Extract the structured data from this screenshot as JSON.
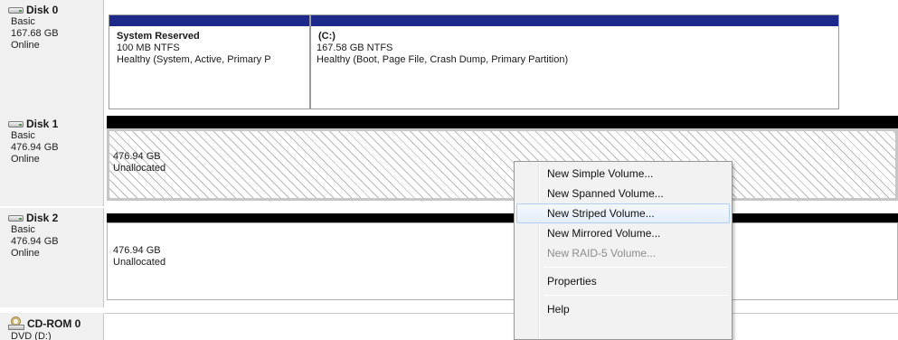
{
  "disks": [
    {
      "name": "Disk 0",
      "type": "Basic",
      "size": "167.68 GB",
      "status": "Online",
      "volumes": [
        {
          "title": "System Reserved",
          "size": "100 MB NTFS",
          "status": "Healthy (System, Active, Primary P",
          "bar_color": "#1d2a8c"
        },
        {
          "title": "(C:)",
          "size": "167.58 GB NTFS",
          "status": "Healthy (Boot, Page File, Crash Dump, Primary Partition)",
          "bar_color": "#1d2a8c"
        }
      ]
    },
    {
      "name": "Disk 1",
      "type": "Basic",
      "size": "476.94 GB",
      "status": "Online",
      "volumes": [
        {
          "size": "476.94 GB",
          "status": "Unallocated",
          "bar_color": "#000000"
        }
      ]
    },
    {
      "name": "Disk 2",
      "type": "Basic",
      "size": "476.94 GB",
      "status": "Online",
      "volumes": [
        {
          "size": "476.94 GB",
          "status": "Unallocated",
          "bar_color": "#000000"
        }
      ]
    },
    {
      "name": "CD-ROM 0",
      "type": "DVD (D:)"
    }
  ],
  "context_menu": {
    "items": [
      {
        "label": "New Simple Volume...",
        "enabled": true
      },
      {
        "label": "New Spanned Volume...",
        "enabled": true
      },
      {
        "label": "New Striped Volume...",
        "enabled": true,
        "highlighted": true
      },
      {
        "label": "New Mirrored Volume...",
        "enabled": true
      },
      {
        "label": "New RAID-5 Volume...",
        "enabled": false
      },
      {
        "label": "Properties",
        "enabled": true
      },
      {
        "label": "Help",
        "enabled": true
      }
    ]
  },
  "colors": {
    "primary_partition_bar": "#1d2a8c",
    "unallocated_bar": "#000000",
    "menu_highlight_border": "#aecff7"
  },
  "icons": [
    "disk-drive-icon",
    "cd-rom-icon"
  ]
}
